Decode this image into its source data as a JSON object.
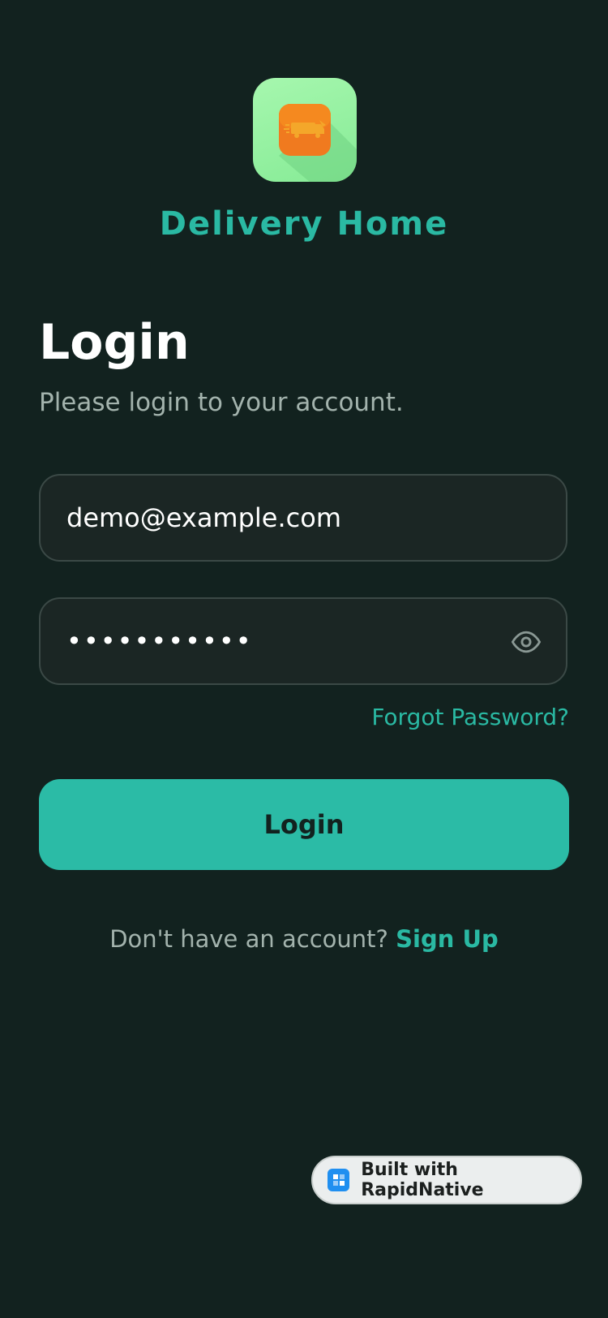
{
  "brand": {
    "app_name": "Delivery Home",
    "logo_icon": "delivery-truck-icon",
    "colors": {
      "background": "#12221f",
      "accent": "#2ab9a3",
      "logo_tile": "#9ef3a6",
      "logo_inner": "#f07a1f"
    }
  },
  "login": {
    "title": "Login",
    "subtitle": "Please login to your account.",
    "email_value": "demo@example.com",
    "password_value": "•••••••••••",
    "password_toggle_icon": "eye-icon",
    "forgot_password": "Forgot Password?",
    "submit_label": "Login",
    "signup_prompt": "Don't have an account?",
    "signup_link": "Sign Up"
  },
  "badge": {
    "label": "Built with RapidNative",
    "icon": "rapidnative-logo-icon"
  }
}
